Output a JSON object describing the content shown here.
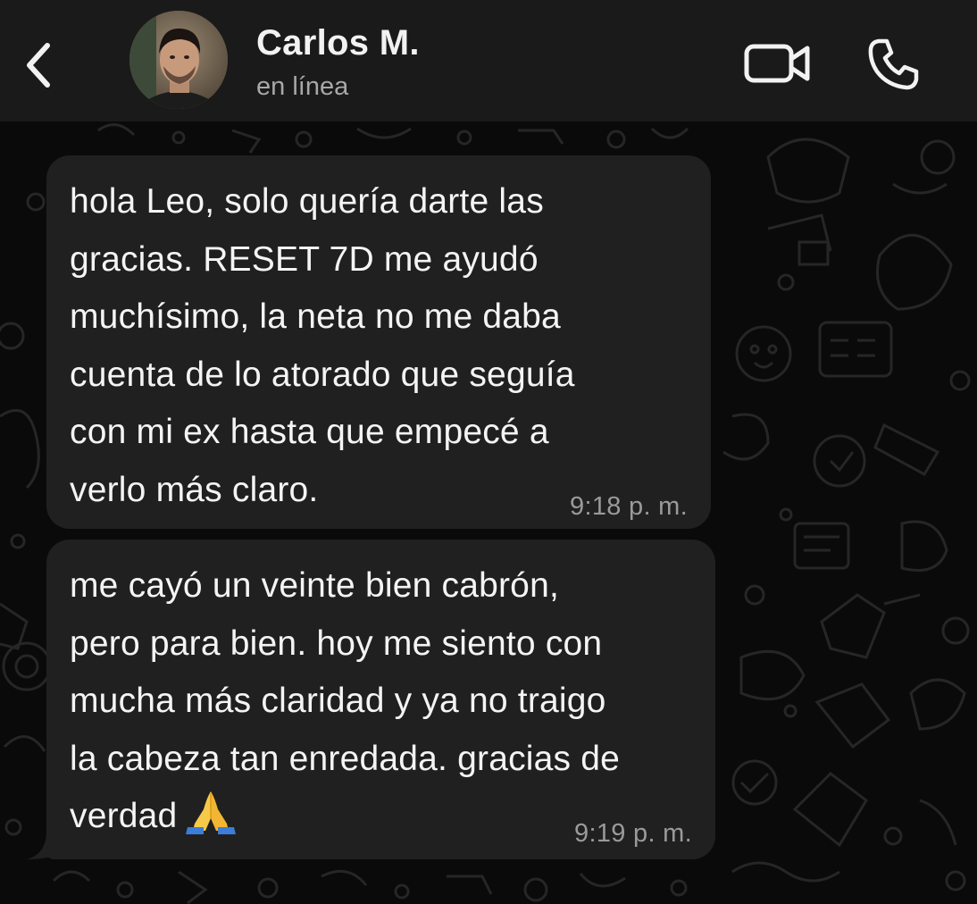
{
  "header": {
    "contact_name": "Carlos M.",
    "contact_status": "en línea",
    "back_icon": "chevron-left-icon",
    "video_icon": "video-camera-icon",
    "call_icon": "phone-icon"
  },
  "messages": [
    {
      "text": "hola Leo, solo quería darte las\ngracias. RESET 7D me ayudó\nmuchísimo, la neta no me daba\ncuenta de lo atorado que seguía\ncon mi ex hasta que empecé a\nverlo más claro.",
      "time": "9:18 p. m."
    },
    {
      "text": "me cayó un veinte bien cabrón,\npero para bien. hoy me siento con\nmucha más claridad y ya no traigo\nla cabeza tan enredada. gracias de\nverdad",
      "emoji": "folded-hands-emoji",
      "time": "9:19 p. m."
    }
  ],
  "colors": {
    "header_bg": "#1a1a1a",
    "chat_bg": "#0a0a0a",
    "bubble_bg": "#202020",
    "text": "#f4f4f4",
    "time_text": "#9a9a9a"
  }
}
